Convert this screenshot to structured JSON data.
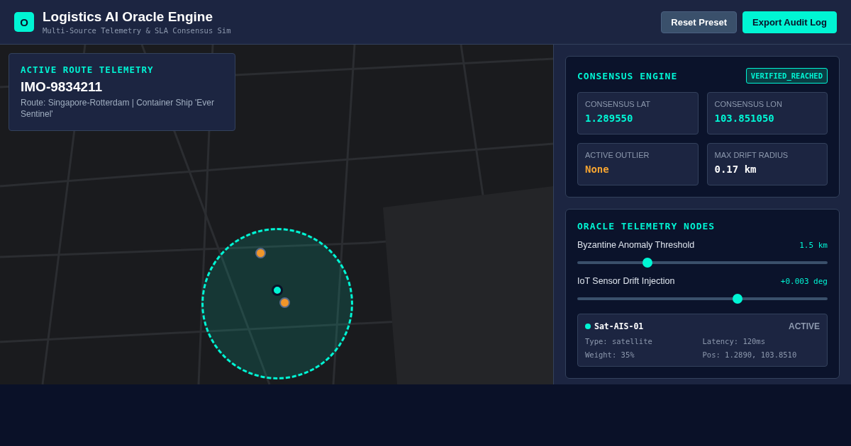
{
  "header": {
    "logo": "O",
    "title": "Logistics AI Oracle Engine",
    "subtitle": "Multi-Source Telemetry & SLA Consensus Sim",
    "buttons": [
      {
        "label": "Reset Preset",
        "kind": "secondary"
      },
      {
        "label": "Export Audit Log",
        "kind": "primary"
      }
    ]
  },
  "route_card": {
    "heading": "ACTIVE ROUTE TELEMETRY",
    "vessel_id": "IMO-9834211",
    "description": "Route: Singapore-Rotterdam | Container Ship 'Ever Sentinel'"
  },
  "map": {
    "markers": [
      {
        "kind": "consensus",
        "color": "#00f5d4"
      },
      {
        "kind": "source",
        "color": "#f0962a"
      },
      {
        "kind": "source",
        "color": "#f0962a"
      }
    ]
  },
  "consensus": {
    "title": "CONSENSUS ENGINE",
    "status": "VERIFIED_REACHED",
    "metrics": [
      {
        "label": "CONSENSUS LAT",
        "value": "1.289550",
        "kind": "accent"
      },
      {
        "label": "CONSENSUS LON",
        "value": "103.851050",
        "kind": "accent"
      },
      {
        "label": "ACTIVE OUTLIER",
        "value": "None",
        "kind": "warning"
      },
      {
        "label": "MAX DRIFT RADIUS",
        "value": "0.17 km",
        "kind": "plain"
      }
    ]
  },
  "nodes_panel": {
    "title": "ORACLE TELEMETRY NODES",
    "sliders": [
      {
        "label": "Byzantine Anomaly Threshold",
        "reading": "1.5 km",
        "level": 0.28
      },
      {
        "label": "IoT Sensor Drift Injection",
        "reading": "+0.003 deg",
        "level": 0.64
      }
    ],
    "nodes": [
      {
        "name": "Sat-AIS-01",
        "status": "ACTIVE",
        "color": "#00f5d4",
        "type": "Type: satellite",
        "latency": "Latency: 120ms",
        "weight": "Weight: 35%",
        "position": "Pos: 1.2890, 103.8510"
      }
    ]
  }
}
